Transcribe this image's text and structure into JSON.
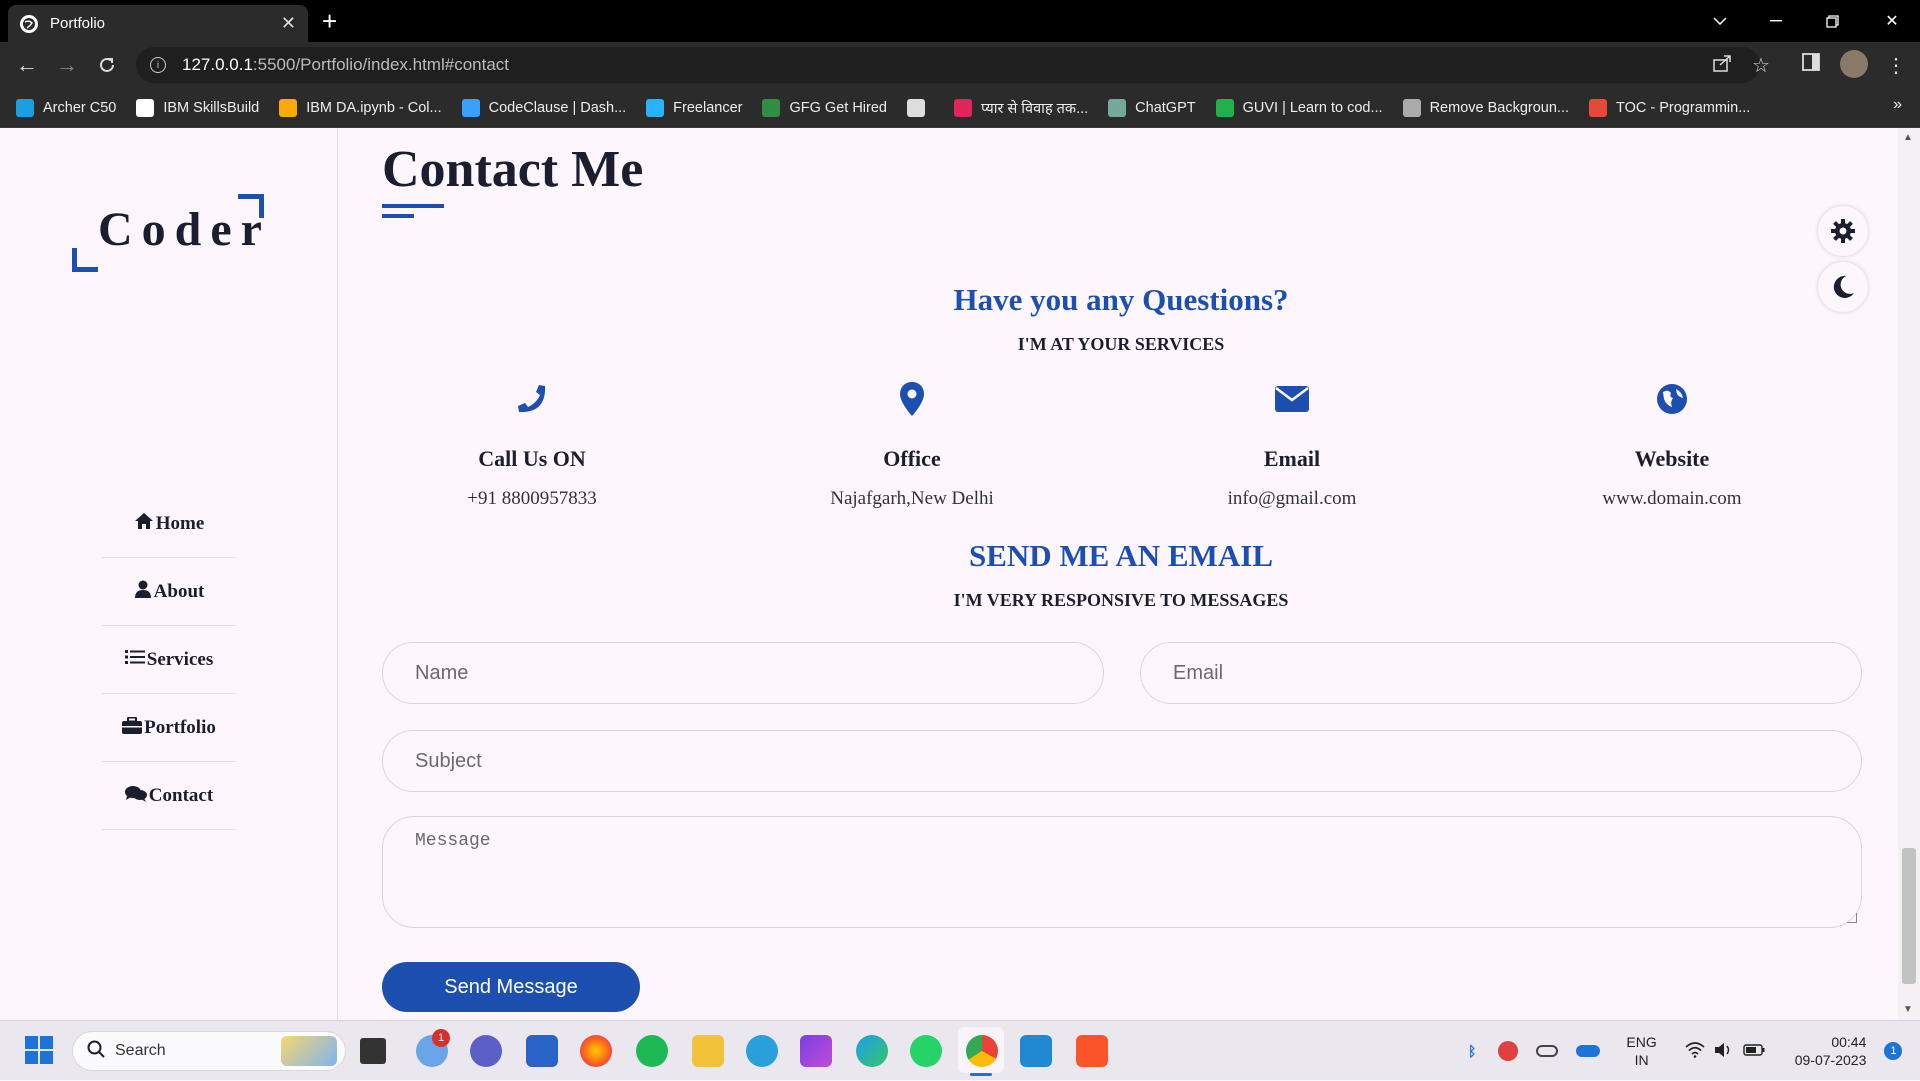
{
  "browser": {
    "tab_title": "Portfolio",
    "url_host": "127.0.0.1",
    "url_path": ":5500/Portfolio/index.html#contact",
    "bookmarks": [
      {
        "label": "Archer C50",
        "color": "#1aa0e0"
      },
      {
        "label": "IBM SkillsBuild",
        "color": "#ffffff"
      },
      {
        "label": "IBM DA.ipynb - Col...",
        "color": "#f9ab00"
      },
      {
        "label": "CodeClause | Dash...",
        "color": "#38a0ff"
      },
      {
        "label": "Freelancer",
        "color": "#29b2fe"
      },
      {
        "label": "GFG Get Hired",
        "color": "#2f8d46"
      },
      {
        "label": "",
        "color": "#dddddd"
      },
      {
        "label": "प्यार से विवाह तक...",
        "color": "#e0245e"
      },
      {
        "label": "ChatGPT",
        "color": "#74aa9c"
      },
      {
        "label": "GUVI | Learn to cod...",
        "color": "#20b14c"
      },
      {
        "label": "Remove Backgroun...",
        "color": "#aaaaaa"
      },
      {
        "label": "TOC - Programmin...",
        "color": "#e64a3b"
      }
    ],
    "bookmarks_more": "»"
  },
  "sidebar": {
    "logo": "Coder",
    "nav": [
      {
        "label": "Home",
        "icon": "home-icon"
      },
      {
        "label": "About",
        "icon": "user-icon"
      },
      {
        "label": "Services",
        "icon": "list-icon"
      },
      {
        "label": "Portfolio",
        "icon": "briefcase-icon"
      },
      {
        "label": "Contact",
        "icon": "comments-icon"
      }
    ]
  },
  "main": {
    "heading": "Contact Me",
    "questions_title": "Have you any Questions?",
    "questions_sub": "I'M AT YOUR SERVICES",
    "info": [
      {
        "label": "Call Us ON",
        "value": "+91 8800957833",
        "icon": "phone-icon"
      },
      {
        "label": "Office",
        "value": "Najafgarh,New Delhi",
        "icon": "location-pin-icon"
      },
      {
        "label": "Email",
        "value": "info@gmail.com",
        "icon": "envelope-icon"
      },
      {
        "label": "Website",
        "value": "www.domain.com",
        "icon": "globe-icon"
      }
    ],
    "email_title": "SEND ME AN EMAIL",
    "email_sub": "I'M VERY RESPONSIVE TO MESSAGES",
    "form": {
      "name_placeholder": "Name",
      "email_placeholder": "Email",
      "subject_placeholder": "Subject",
      "message_placeholder": "Message",
      "send_label": "Send Message"
    }
  },
  "colors": {
    "accent": "#1d4fb0",
    "text": "#1a1e2e",
    "background": "#fdf7fd"
  },
  "taskbar": {
    "search_label": "Search",
    "notification_badge": "1",
    "lang": "ENG",
    "region": "IN",
    "time": "00:44",
    "date": "09-07-2023",
    "tray_badge": "1"
  }
}
